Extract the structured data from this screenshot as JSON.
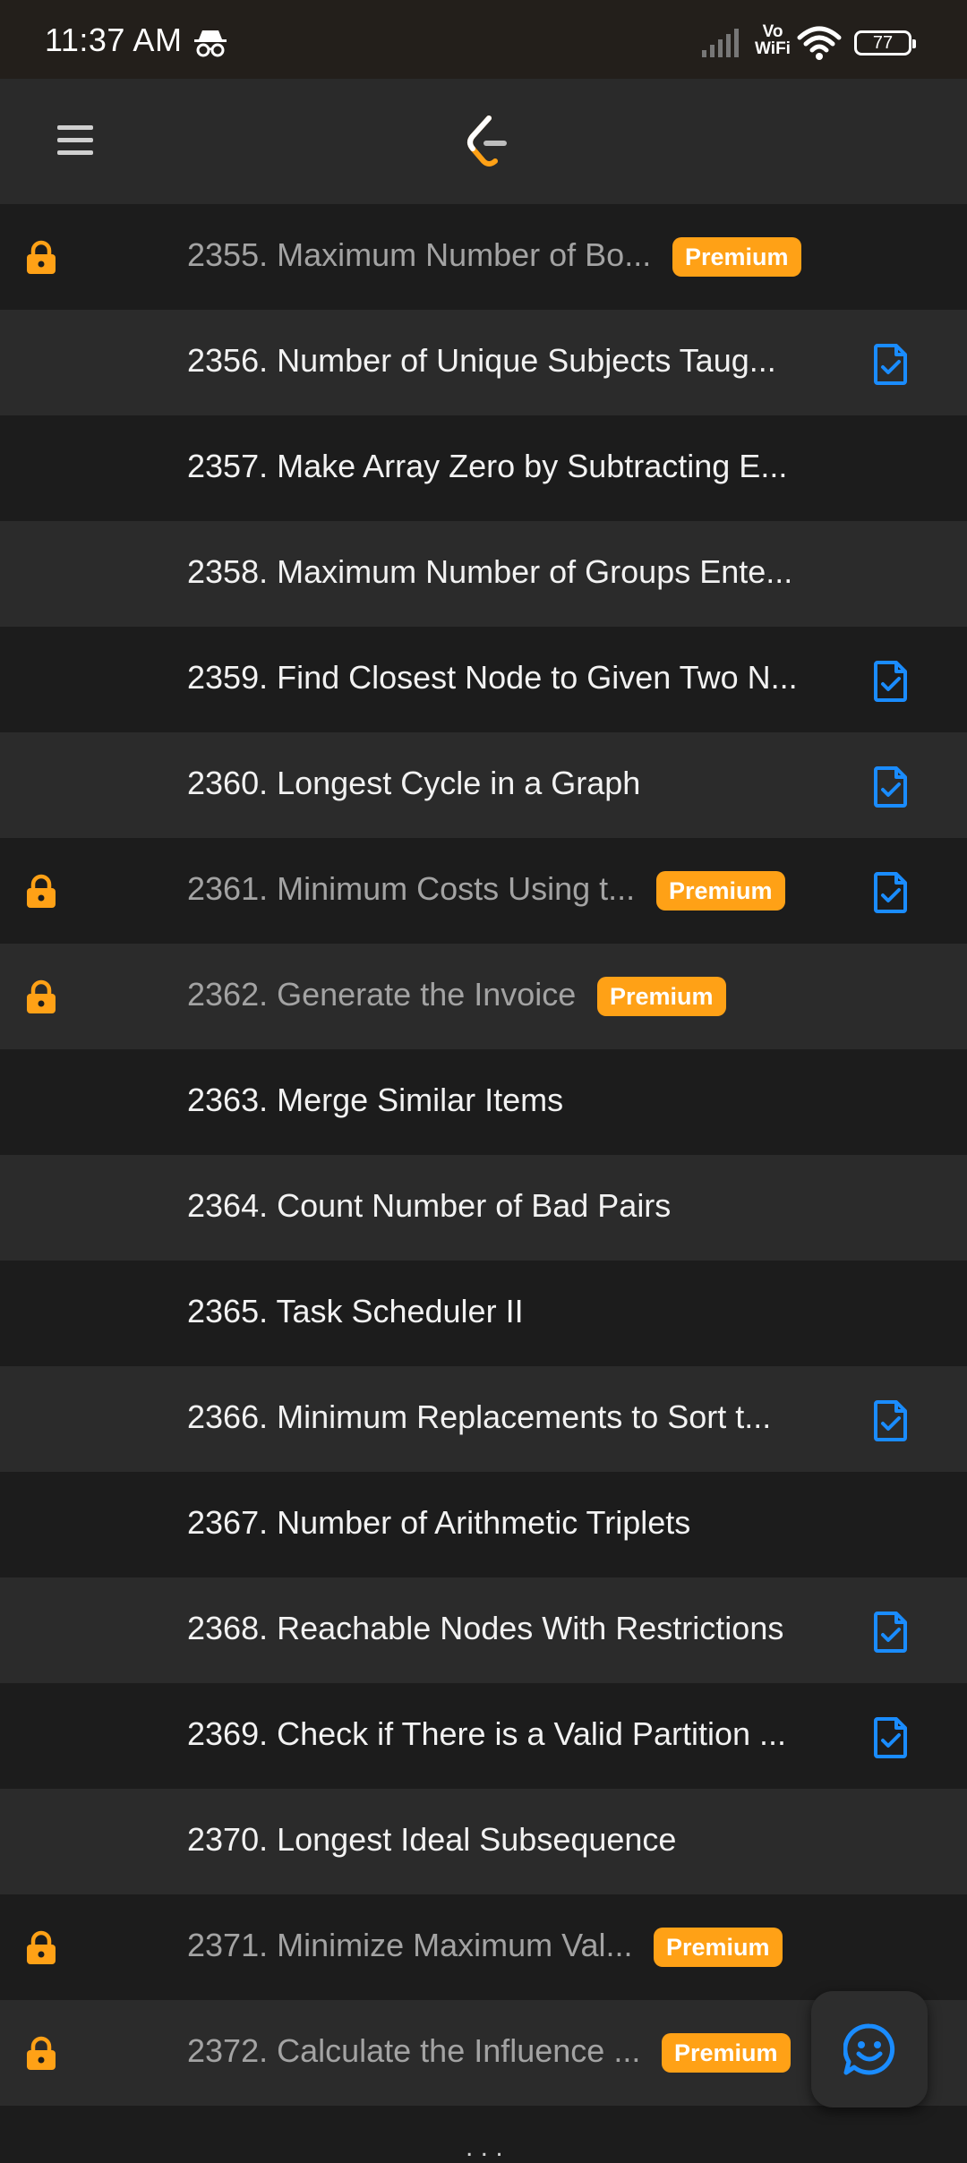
{
  "status_bar": {
    "time": "11:37 AM",
    "network_label": "Vo\nWiFi",
    "vo_label": "Vo",
    "wifi_label": "WiFi",
    "battery": "77"
  },
  "app_bar": {
    "menu_icon": "hamburger-menu-icon",
    "logo_icon": "leetcode-logo-icon"
  },
  "colors": {
    "premium": "#ffa116",
    "lock": "#ffa116",
    "solution_icon": "#1a8cff",
    "row_dark": "#1c1c1c",
    "row_light": "#2b2b2b"
  },
  "premium_label": "Premium",
  "problems": [
    {
      "title": "2355. Maximum Number of Bo...",
      "locked": true,
      "premium": true,
      "solution": false
    },
    {
      "title": "2356. Number of Unique Subjects Taug...",
      "locked": false,
      "premium": false,
      "solution": true
    },
    {
      "title": "2357. Make Array Zero by Subtracting E...",
      "locked": false,
      "premium": false,
      "solution": false
    },
    {
      "title": "2358. Maximum Number of Groups Ente...",
      "locked": false,
      "premium": false,
      "solution": false
    },
    {
      "title": "2359. Find Closest Node to Given Two N...",
      "locked": false,
      "premium": false,
      "solution": true
    },
    {
      "title": "2360. Longest Cycle in a Graph",
      "locked": false,
      "premium": false,
      "solution": true
    },
    {
      "title": "2361. Minimum Costs Using t...",
      "locked": true,
      "premium": true,
      "solution": true
    },
    {
      "title": "2362. Generate the Invoice",
      "locked": true,
      "premium": true,
      "solution": false
    },
    {
      "title": "2363. Merge Similar Items",
      "locked": false,
      "premium": false,
      "solution": false
    },
    {
      "title": "2364. Count Number of Bad Pairs",
      "locked": false,
      "premium": false,
      "solution": false
    },
    {
      "title": "2365. Task Scheduler II",
      "locked": false,
      "premium": false,
      "solution": false
    },
    {
      "title": "2366. Minimum Replacements to Sort t...",
      "locked": false,
      "premium": false,
      "solution": true
    },
    {
      "title": "2367. Number of Arithmetic Triplets",
      "locked": false,
      "premium": false,
      "solution": false
    },
    {
      "title": "2368. Reachable Nodes With Restrictions",
      "locked": false,
      "premium": false,
      "solution": true
    },
    {
      "title": "2369. Check if There is a Valid Partition ...",
      "locked": false,
      "premium": false,
      "solution": true
    },
    {
      "title": "2370. Longest Ideal Subsequence",
      "locked": false,
      "premium": false,
      "solution": false
    },
    {
      "title": "2371. Minimize Maximum Val...",
      "locked": true,
      "premium": true,
      "solution": false
    },
    {
      "title": "2372. Calculate the Influence ...",
      "locked": true,
      "premium": true,
      "solution": false
    }
  ],
  "fab": {
    "icon": "smiley-chat-icon"
  }
}
